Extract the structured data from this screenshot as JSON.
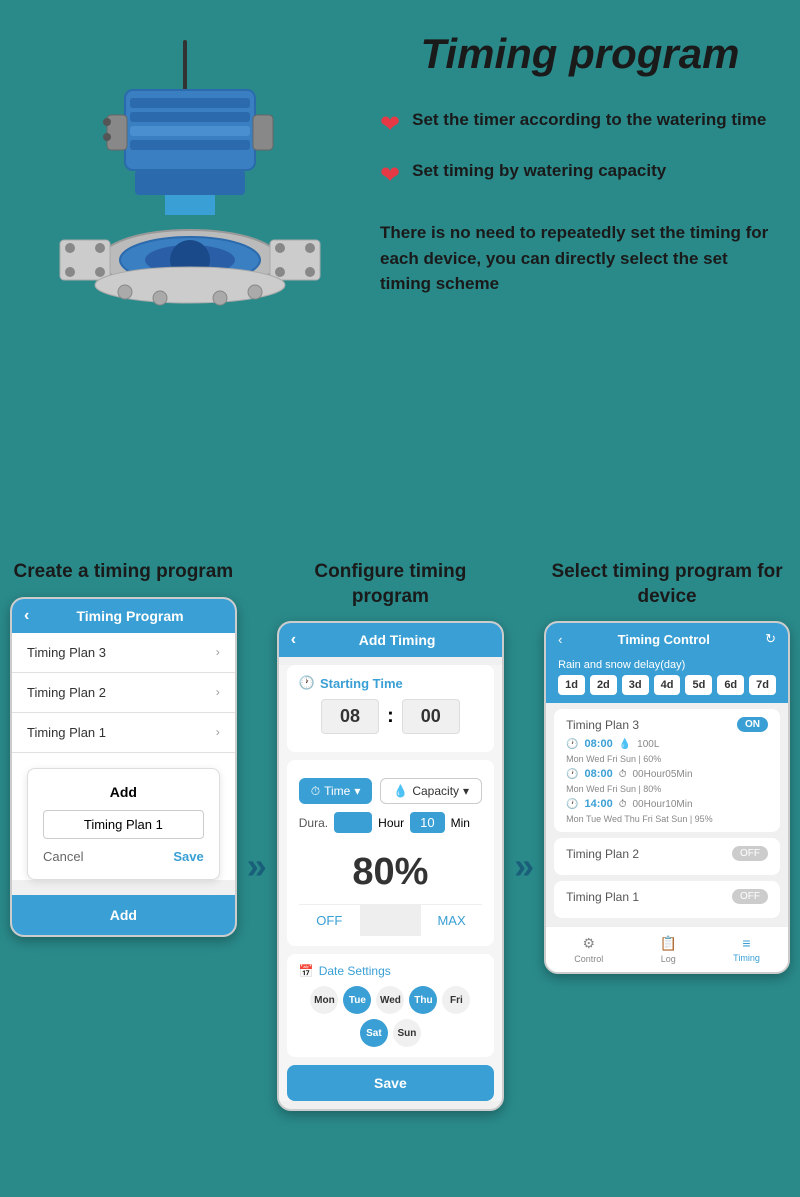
{
  "page": {
    "background_color": "#2a8a8a",
    "title": "Timing program"
  },
  "hero": {
    "title": "Timing program",
    "features": [
      {
        "id": "feature1",
        "text": "Set the timer according to the watering time"
      },
      {
        "id": "feature2",
        "text": "Set timing by watering capacity"
      }
    ],
    "description": "There is no need to repeatedly set the timing for each device, you can directly select the set timing scheme"
  },
  "steps": [
    {
      "id": "step1",
      "title": "Create a timing program",
      "phone": {
        "header_title": "Timing Program",
        "list_items": [
          "Timing Plan 3",
          "Timing Plan 2",
          "Timing Plan 1"
        ],
        "dialog": {
          "title": "Add",
          "input_value": "Timing Plan 1",
          "cancel_label": "Cancel",
          "save_label": "Save"
        },
        "footer_label": "Add"
      }
    },
    {
      "id": "step2",
      "title": "Configure timing program",
      "phone": {
        "header_title": "Add Timing",
        "starting_time_label": "Starting Time",
        "time_hour": "08",
        "time_minute": "00",
        "type_option1": "Time",
        "type_option2": "Capacity",
        "dura_label": "Dura.",
        "dura_hour_label": "Hour",
        "dura_minute_value": "10",
        "dura_minute_label": "Min",
        "percent": "80%",
        "off_label": "OFF",
        "max_label": "MAX",
        "date_settings_label": "Date Settings",
        "days": [
          {
            "label": "Mon",
            "active": false
          },
          {
            "label": "Tue",
            "active": true
          },
          {
            "label": "Wed",
            "active": false
          },
          {
            "label": "Thu",
            "active": true
          },
          {
            "label": "Fri",
            "active": false
          },
          {
            "label": "Sat",
            "active": true
          },
          {
            "label": "Sun",
            "active": false
          }
        ],
        "save_label": "Save"
      }
    },
    {
      "id": "step3",
      "title": "Select timing program for device",
      "phone": {
        "header_title": "Timing Control",
        "rain_snow_text": "Rain and snow delay(day)",
        "delay_days": [
          "1d",
          "2d",
          "3d",
          "4d",
          "5d",
          "6d",
          "7d"
        ],
        "plans": [
          {
            "name": "Timing Plan 3",
            "toggle": "ON",
            "entries": [
              {
                "time": "08:00",
                "capacity": "100L",
                "days": "Mon Wed Fri Sun",
                "percent": "60%"
              },
              {
                "time": "08:00",
                "capacity": "00Hour05Min",
                "days": "Mon Wed Fri Sun",
                "percent": "80%"
              },
              {
                "time": "14:00",
                "capacity": "00Hour10Min",
                "days": "Mon Tue Wed Thu Fri Sat Sun",
                "percent": "95%"
              }
            ]
          },
          {
            "name": "Timing Plan 2",
            "toggle": "OFF",
            "entries": []
          },
          {
            "name": "Timing Plan 1",
            "toggle": "OFF",
            "entries": []
          }
        ],
        "footer_tabs": [
          {
            "label": "Control",
            "icon": "⚙",
            "active": false
          },
          {
            "label": "Log",
            "icon": "📋",
            "active": false
          },
          {
            "label": "Timing",
            "icon": "≡",
            "active": true
          }
        ]
      }
    }
  ],
  "arrows": [
    {
      "label": "»"
    },
    {
      "label": "»"
    }
  ]
}
